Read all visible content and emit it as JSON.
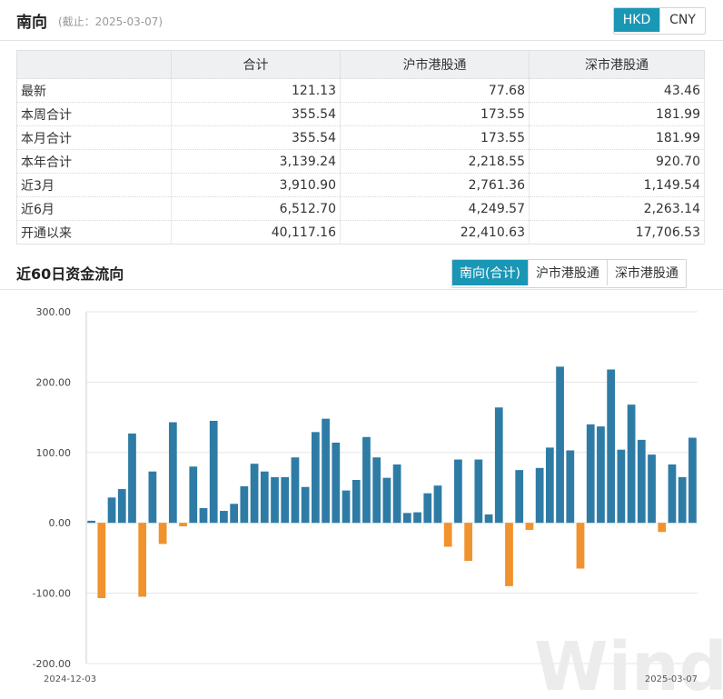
{
  "header": {
    "title": "南向",
    "as_of": "(截止：2025-03-07)",
    "currency_options": [
      {
        "label": "HKD",
        "active": true
      },
      {
        "label": "CNY",
        "active": false
      }
    ]
  },
  "stats_table": {
    "columns": [
      "",
      "合计",
      "沪市港股通",
      "深市港股通"
    ],
    "rows": [
      {
        "label": "最新",
        "total": "121.13",
        "sh": "77.68",
        "sz": "43.46"
      },
      {
        "label": "本周合计",
        "total": "355.54",
        "sh": "173.55",
        "sz": "181.99"
      },
      {
        "label": "本月合计",
        "total": "355.54",
        "sh": "173.55",
        "sz": "181.99"
      },
      {
        "label": "本年合计",
        "total": "3,139.24",
        "sh": "2,218.55",
        "sz": "920.70"
      },
      {
        "label": "近3月",
        "total": "3,910.90",
        "sh": "2,761.36",
        "sz": "1,149.54"
      },
      {
        "label": "近6月",
        "total": "6,512.70",
        "sh": "4,249.57",
        "sz": "2,263.14"
      },
      {
        "label": "开通以来",
        "total": "40,117.16",
        "sh": "22,410.63",
        "sz": "17,706.53"
      }
    ]
  },
  "flow_section": {
    "title": "近60日资金流向",
    "tabs": [
      {
        "label": "南向(合计)",
        "active": true
      },
      {
        "label": "沪市港股通",
        "active": false
      },
      {
        "label": "深市港股通",
        "active": false
      }
    ]
  },
  "watermark": "Wind",
  "colors": {
    "accent": "#1a97b5",
    "positive_bar": "#2e7ca6",
    "negative_bar": "#f0922e"
  },
  "chart_data": {
    "type": "bar",
    "ylim": [
      -200,
      300
    ],
    "y_ticks": [
      "300.00",
      "200.00",
      "100.00",
      "0.00",
      "-100.00",
      "-200.00"
    ],
    "y_tick_values": [
      300,
      200,
      100,
      0,
      -100,
      -200
    ],
    "x_start_label": "2024-12-03",
    "x_end_label": "2025-03-07",
    "values": [
      3,
      -107,
      36,
      48,
      127,
      -105,
      73,
      -30,
      143,
      -5,
      80,
      21,
      145,
      17,
      27,
      52,
      84,
      73,
      65,
      65,
      93,
      51,
      129,
      148,
      114,
      46,
      61,
      122,
      93,
      64,
      83,
      14,
      15,
      42,
      53,
      -34,
      90,
      -54,
      90,
      12,
      164,
      -90,
      75,
      -10,
      78,
      107,
      222,
      103,
      -65,
      140,
      137,
      218,
      104,
      168,
      118,
      97,
      -13,
      83,
      65,
      121
    ]
  }
}
